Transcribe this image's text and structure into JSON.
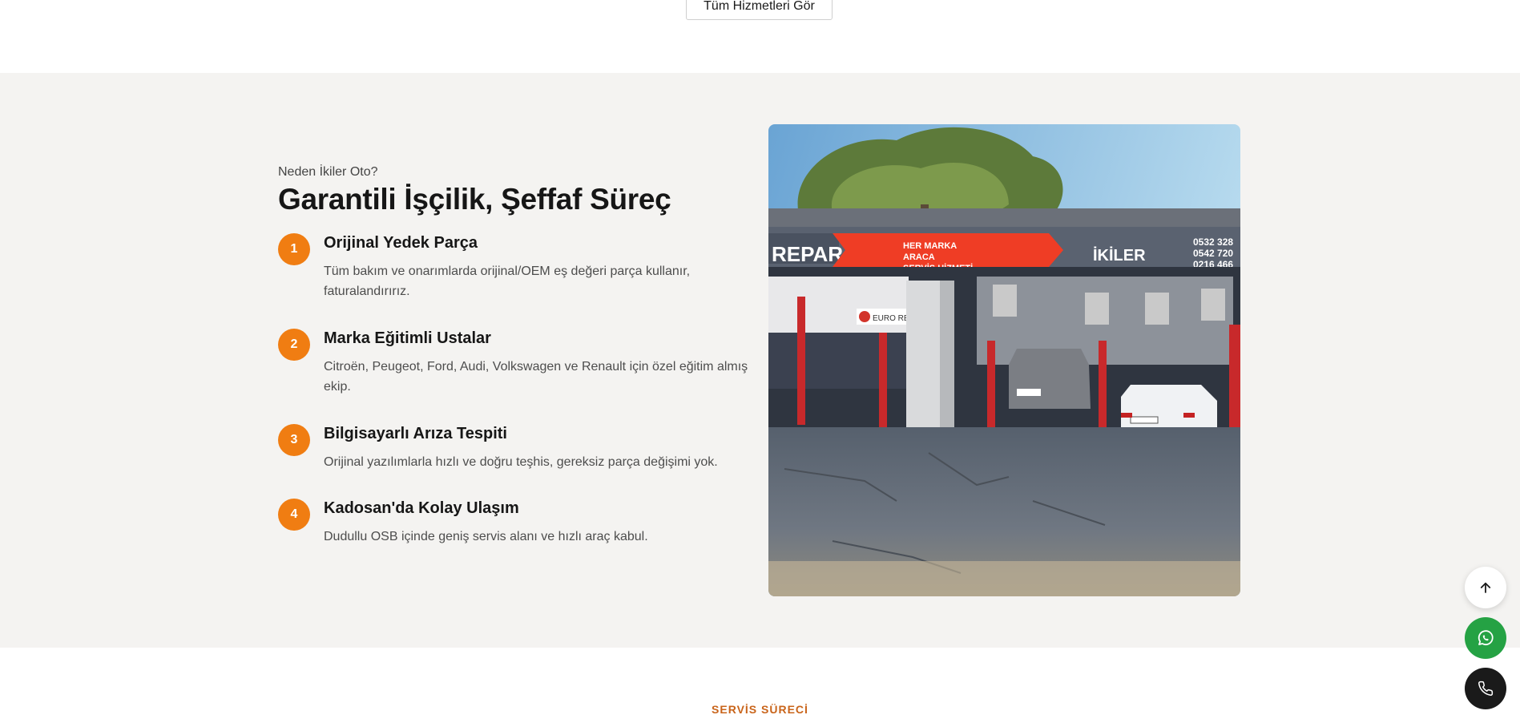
{
  "top": {
    "all_services_label": "Tüm Hizmetleri Gör"
  },
  "why": {
    "eyebrow": "Neden İkiler Oto?",
    "title": "Garantili İşçilik, Şeffaf Süreç",
    "features": [
      {
        "num": "1",
        "title": "Orijinal Yedek Parça",
        "desc": "Tüm bakım ve onarımlarda orijinal/OEM eş değeri parça kullanır, faturalandırırız."
      },
      {
        "num": "2",
        "title": "Marka Eğitimli Ustalar",
        "desc": "Citroën, Peugeot, Ford, Audi, Volkswagen ve Renault için özel eğitim almış ekip."
      },
      {
        "num": "3",
        "title": "Bilgisayarlı Arıza Tespiti",
        "desc": "Orijinal yazılımlarla hızlı ve doğru teşhis, gereksiz parça değişimi yok."
      },
      {
        "num": "4",
        "title": "Kadosan'da Kolay Ulaşım",
        "desc": "Dudullu OSB içinde geniş servis alanı ve hızlı araç kabul."
      }
    ],
    "photo": {
      "sign_left": "REPAR",
      "banner_line1": "HER MARKA",
      "banner_line2": "ARACA",
      "banner_line3": "SERVİS HİZMETİ",
      "sign_brand": "İKİLER",
      "phone1": "0532 328",
      "phone2": "0542 720",
      "phone3": "0216 466",
      "inner_sign": "EURO REPA"
    }
  },
  "process": {
    "eyebrow": "SERVİS SÜRECİ"
  },
  "icons": {
    "scroll_top": "arrow-up-icon",
    "whatsapp": "whatsapp-icon",
    "phone": "phone-icon"
  },
  "colors": {
    "accent": "#f07d12",
    "section_bg": "#f4f3f1",
    "whatsapp": "#25a244",
    "dark": "#1a1a1a",
    "eyebrow_orange": "#c9641a"
  }
}
